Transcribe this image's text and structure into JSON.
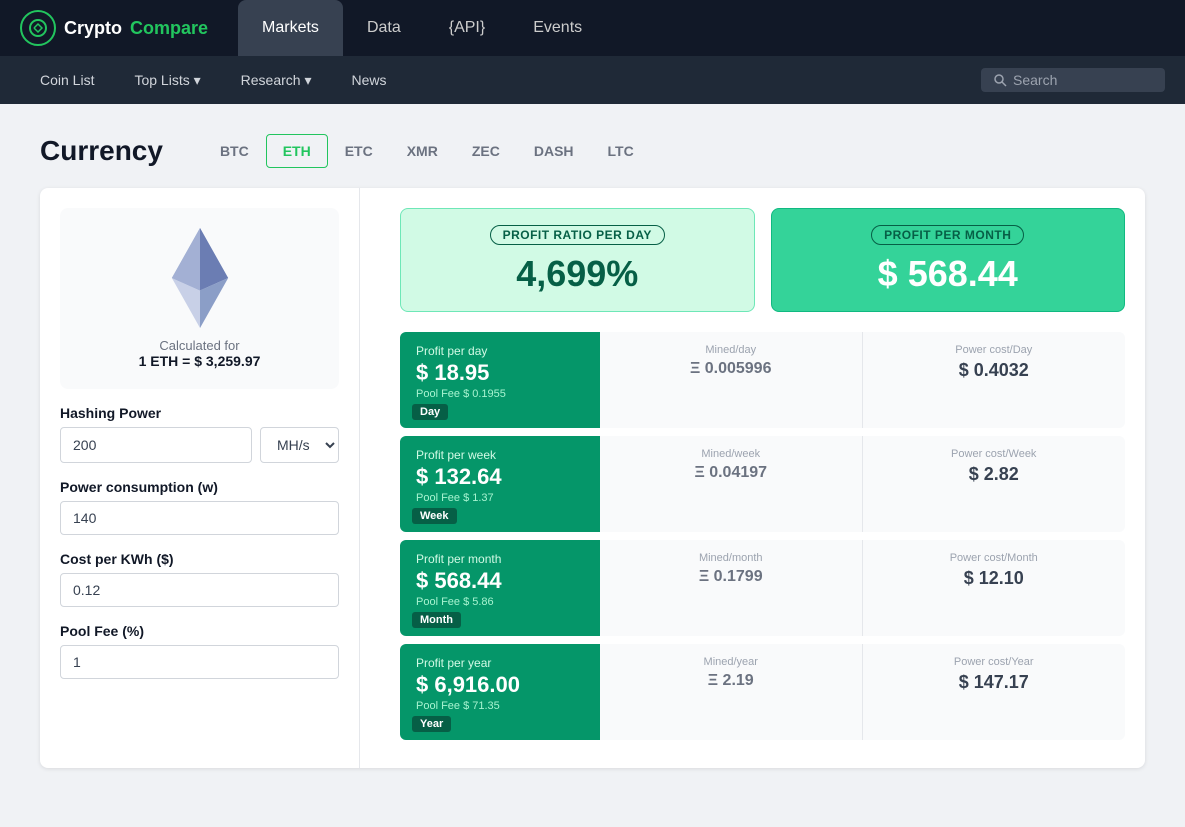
{
  "logo": {
    "text_crypto": "Crypto",
    "text_compare": "Compare"
  },
  "top_nav": {
    "tabs": [
      {
        "label": "Markets",
        "active": true
      },
      {
        "label": "Data",
        "active": false
      },
      {
        "label": "{API}",
        "active": false
      },
      {
        "label": "Events",
        "active": false
      }
    ]
  },
  "sub_nav": {
    "items": [
      {
        "label": "Coin List"
      },
      {
        "label": "Top Lists ▾"
      },
      {
        "label": "Research ▾"
      },
      {
        "label": "News"
      }
    ],
    "search_placeholder": "Search"
  },
  "currency": {
    "title": "Currency",
    "tabs": [
      {
        "label": "BTC",
        "active": false
      },
      {
        "label": "ETH",
        "active": true
      },
      {
        "label": "ETC",
        "active": false
      },
      {
        "label": "XMR",
        "active": false
      },
      {
        "label": "ZEC",
        "active": false
      },
      {
        "label": "DASH",
        "active": false
      },
      {
        "label": "LTC",
        "active": false
      }
    ]
  },
  "left_panel": {
    "calculated_for_line1": "Calculated for",
    "calculated_for_line2": "1 ETH = $ 3,259.97",
    "hashing_power_label": "Hashing Power",
    "hashing_power_value": "200",
    "hashing_unit": "MH/s",
    "power_consumption_label": "Power consumption (w)",
    "power_consumption_value": "140",
    "cost_per_kwh_label": "Cost per KWh ($)",
    "cost_per_kwh_value": "0.12",
    "pool_fee_label": "Pool Fee (%)",
    "pool_fee_value": "1"
  },
  "summary_cards": [
    {
      "label": "PROFIT RATIO PER DAY",
      "value": "4,699%",
      "type": "light"
    },
    {
      "label": "PROFIT PER MONTH",
      "value": "$ 568.44",
      "type": "dark"
    }
  ],
  "data_rows": [
    {
      "period": "Day",
      "profit_label": "Profit per day",
      "profit_value": "$ 18.95",
      "pool_fee": "Pool Fee $ 0.1955",
      "mined_label": "Mined/day",
      "mined_value": "Ξ 0.005996",
      "power_label": "Power cost/Day",
      "power_value": "$ 0.4032"
    },
    {
      "period": "Week",
      "profit_label": "Profit per week",
      "profit_value": "$ 132.64",
      "pool_fee": "Pool Fee $ 1.37",
      "mined_label": "Mined/week",
      "mined_value": "Ξ 0.04197",
      "power_label": "Power cost/Week",
      "power_value": "$ 2.82"
    },
    {
      "period": "Month",
      "profit_label": "Profit per month",
      "profit_value": "$ 568.44",
      "pool_fee": "Pool Fee $ 5.86",
      "mined_label": "Mined/month",
      "mined_value": "Ξ 0.1799",
      "power_label": "Power cost/Month",
      "power_value": "$ 12.10"
    },
    {
      "period": "Year",
      "profit_label": "Profit per year",
      "profit_value": "$ 6,916.00",
      "pool_fee": "Pool Fee $ 71.35",
      "mined_label": "Mined/year",
      "mined_value": "Ξ 2.19",
      "power_label": "Power cost/Year",
      "power_value": "$ 147.17"
    }
  ]
}
